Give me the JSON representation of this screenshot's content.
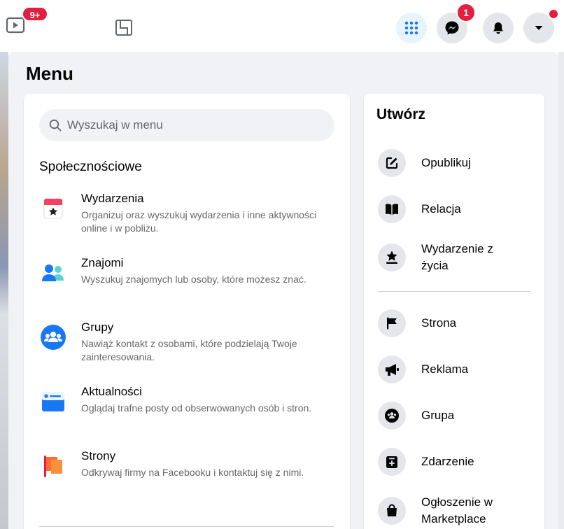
{
  "topbar": {
    "watch_badge": "9+",
    "messenger_badge": "1"
  },
  "menu": {
    "title": "Menu",
    "search_placeholder": "Wyszukaj w menu",
    "section_title": "Społecznościowe",
    "items": [
      {
        "title": "Wydarzenia",
        "desc": "Organizuj oraz wyszukuj wydarzenia i inne aktywności online i w pobliżu.",
        "icon": "calendar-icon"
      },
      {
        "title": "Znajomi",
        "desc": "Wyszukuj znajomych lub osoby, które możesz znać.",
        "icon": "friends-icon"
      },
      {
        "title": "Grupy",
        "desc": "Nawiąż kontakt z osobami, które podzielają Twoje zainteresowania.",
        "icon": "groups-icon"
      },
      {
        "title": "Aktualności",
        "desc": "Oglądaj trafne posty od obserwowanych osób i stron.",
        "icon": "news-feed-icon"
      },
      {
        "title": "Strony",
        "desc": "Odkrywaj firmy na Facebooku i kontaktuj się z nimi.",
        "icon": "pages-flag-icon"
      }
    ]
  },
  "create": {
    "title": "Utwórz",
    "items": [
      {
        "label": "Opublikuj",
        "icon": "compose-icon"
      },
      {
        "label": "Relacja",
        "icon": "book-icon"
      },
      {
        "label": "Wydarzenie z życia",
        "icon": "life-event-star-icon"
      },
      {
        "label": "Strona",
        "icon": "flag-icon"
      },
      {
        "label": "Reklama",
        "icon": "megaphone-icon"
      },
      {
        "label": "Grupa",
        "icon": "group-icon"
      },
      {
        "label": "Zdarzenie",
        "icon": "event-plus-icon"
      },
      {
        "label": "Ogłoszenie w Marketplace",
        "icon": "shopping-bag-icon"
      }
    ]
  },
  "colors": {
    "accent": "#1877f2",
    "badge": "#e41e3f",
    "panel_bg": "#f0f2f5"
  }
}
